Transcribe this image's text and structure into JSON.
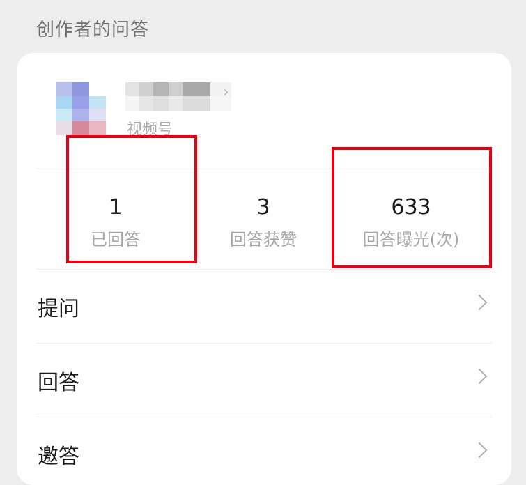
{
  "section_title": "创作者的问答",
  "profile": {
    "account_type": "视频号"
  },
  "stats": [
    {
      "value": "1",
      "label": "已回答"
    },
    {
      "value": "3",
      "label": "回答获赞"
    },
    {
      "value": "633",
      "label": "回答曝光(次)"
    }
  ],
  "menu": [
    {
      "label": "提问"
    },
    {
      "label": "回答"
    },
    {
      "label": "邀答"
    }
  ],
  "colors": {
    "highlight": "#e60012",
    "background": "#ededed",
    "card": "#ffffff"
  },
  "icons": {
    "chevron": "chevron-right-icon"
  }
}
